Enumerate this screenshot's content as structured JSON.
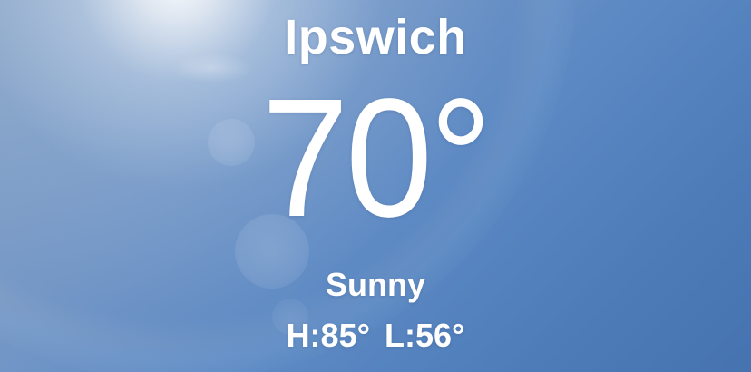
{
  "location": {
    "city": "Ipswich"
  },
  "current": {
    "temperature": "70°",
    "condition": "Sunny",
    "high": "H:85°",
    "low": "L:56°"
  },
  "colors": {
    "sky_top": "#8aa5c7",
    "sky_bottom": "#4673b0",
    "text": "#ffffff"
  },
  "icons": {
    "background": "sun-glare"
  }
}
